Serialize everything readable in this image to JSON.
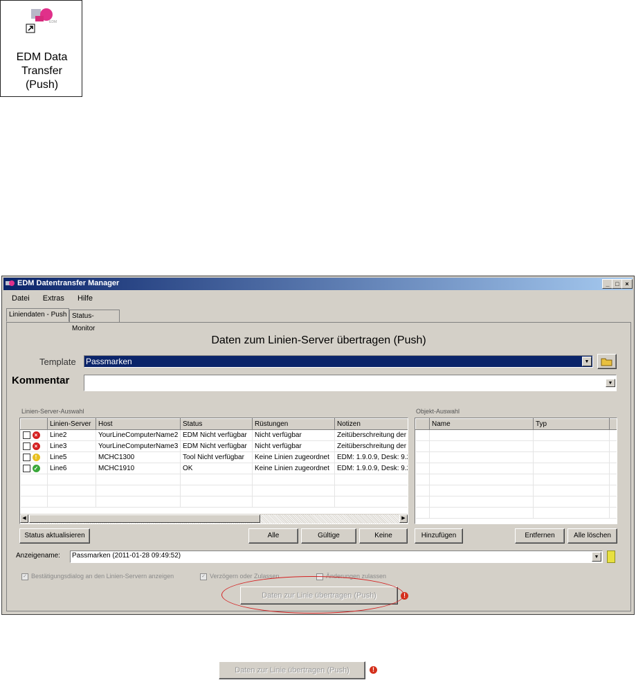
{
  "shortcut": {
    "label_line1": "EDM Data",
    "label_line2": "Transfer",
    "label_line3": "(Push)"
  },
  "window": {
    "title": "EDM Datentransfer Manager",
    "menu": [
      "Datei",
      "Extras",
      "Hilfe"
    ],
    "tabs": [
      "Liniendaten - Push",
      "Status-Monitor"
    ],
    "heading": "Daten zum Linien-Server übertragen (Push)",
    "template_label": "Template",
    "template_value": "Passmarken",
    "comment_label": "Kommentar",
    "comment_value": "",
    "server_group": "Linien-Server-Auswahl",
    "object_group": "Objekt-Auswahl",
    "server_columns": [
      "",
      "Linien-Server",
      "Host",
      "Status",
      "Rüstungen",
      "Notizen"
    ],
    "server_rows": [
      {
        "state": "error",
        "line": "Line2",
        "host": "YourLineComputerName2",
        "status": "EDM  Nicht verfügbar",
        "ruest": "Nicht verfügbar",
        "notes": "Zeitüberschreitung der"
      },
      {
        "state": "error",
        "line": "Line3",
        "host": "YourLineComputerName3",
        "status": "EDM  Nicht verfügbar",
        "ruest": "Nicht verfügbar",
        "notes": "Zeitüberschreitung der"
      },
      {
        "state": "warning",
        "line": "Line5",
        "host": "MCHC1300",
        "status": "Tool  Nicht verfügbar",
        "ruest": "Keine Linien zugeordnet",
        "notes": "EDM: 1.9.0.9, Desk: 9.2."
      },
      {
        "state": "ok",
        "line": "Line6",
        "host": "MCHC1910",
        "status": "OK",
        "ruest": "Keine Linien zugeordnet",
        "notes": "EDM: 1.9.0.9, Desk: 9.2."
      }
    ],
    "object_columns": [
      "",
      "Name",
      "Typ"
    ],
    "buttons": {
      "status": "Status aktualisieren",
      "all": "Alle",
      "valid": "Gültige",
      "none": "Keine",
      "add": "Hinzufügen",
      "remove": "Entfernen",
      "clear": "Alle löschen"
    },
    "display_name_label": "Anzeigename:",
    "display_name_value": "Passmarken (2011-01-28 09:49:52)",
    "options": [
      "Bestätigungsdialog an den Linien-Servern anzeigen",
      "Verzögern oder Zulassen",
      "Änderungen zulassen"
    ],
    "transfer_button": "Daten zur Linie übertragen (Push)"
  },
  "zoom_button": "Daten zur Linie übertragen (Push)"
}
